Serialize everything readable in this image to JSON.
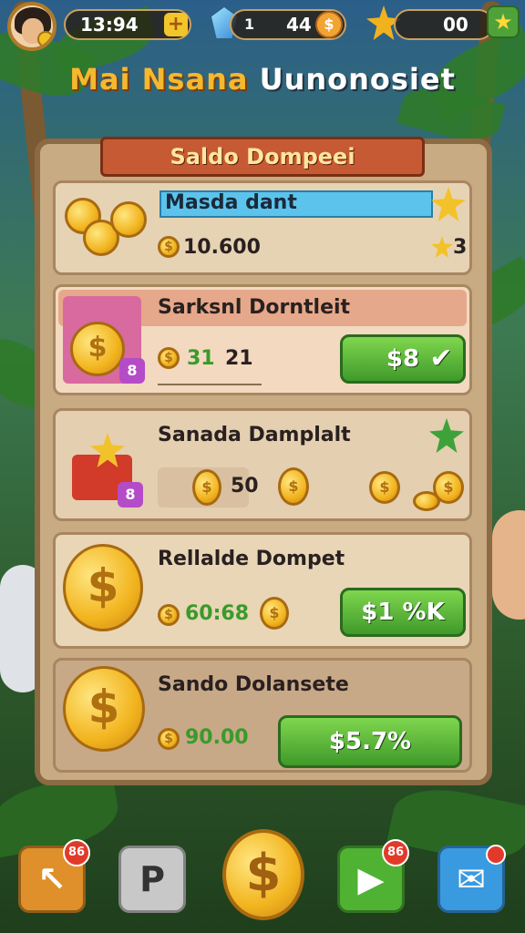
{
  "header": {
    "player_level": "13:94",
    "gems": "44",
    "gem_index": "1",
    "stars": "00",
    "plus_label": "+"
  },
  "title": {
    "part1": "Mai Nsana",
    "part2": "Uunonosiet"
  },
  "panel": {
    "banner": "Saldo Dompeei",
    "cards": [
      {
        "name": "Masda dant",
        "amount": "10.600",
        "star_count": "3"
      },
      {
        "name": "Sarksnl Dorntleit",
        "amount": "31",
        "amount_secondary": "21",
        "price": "$8"
      },
      {
        "name": "Sanada Damplalt",
        "amount": "50"
      },
      {
        "name": "Rellalde Dompet",
        "amount": "60:68",
        "price": "$1 %K"
      },
      {
        "name": "Sando Dolansete",
        "amount": "90.00",
        "price": "$5.7%"
      }
    ]
  },
  "bottom_nav": {
    "badges": [
      "86",
      "86"
    ],
    "center_symbol": "$",
    "btn2_label": "P"
  },
  "colors": {
    "banner": "#c65a34",
    "buy_button": "#4fb233",
    "coin": "#f2b41e",
    "panel": "#c9ab83"
  }
}
